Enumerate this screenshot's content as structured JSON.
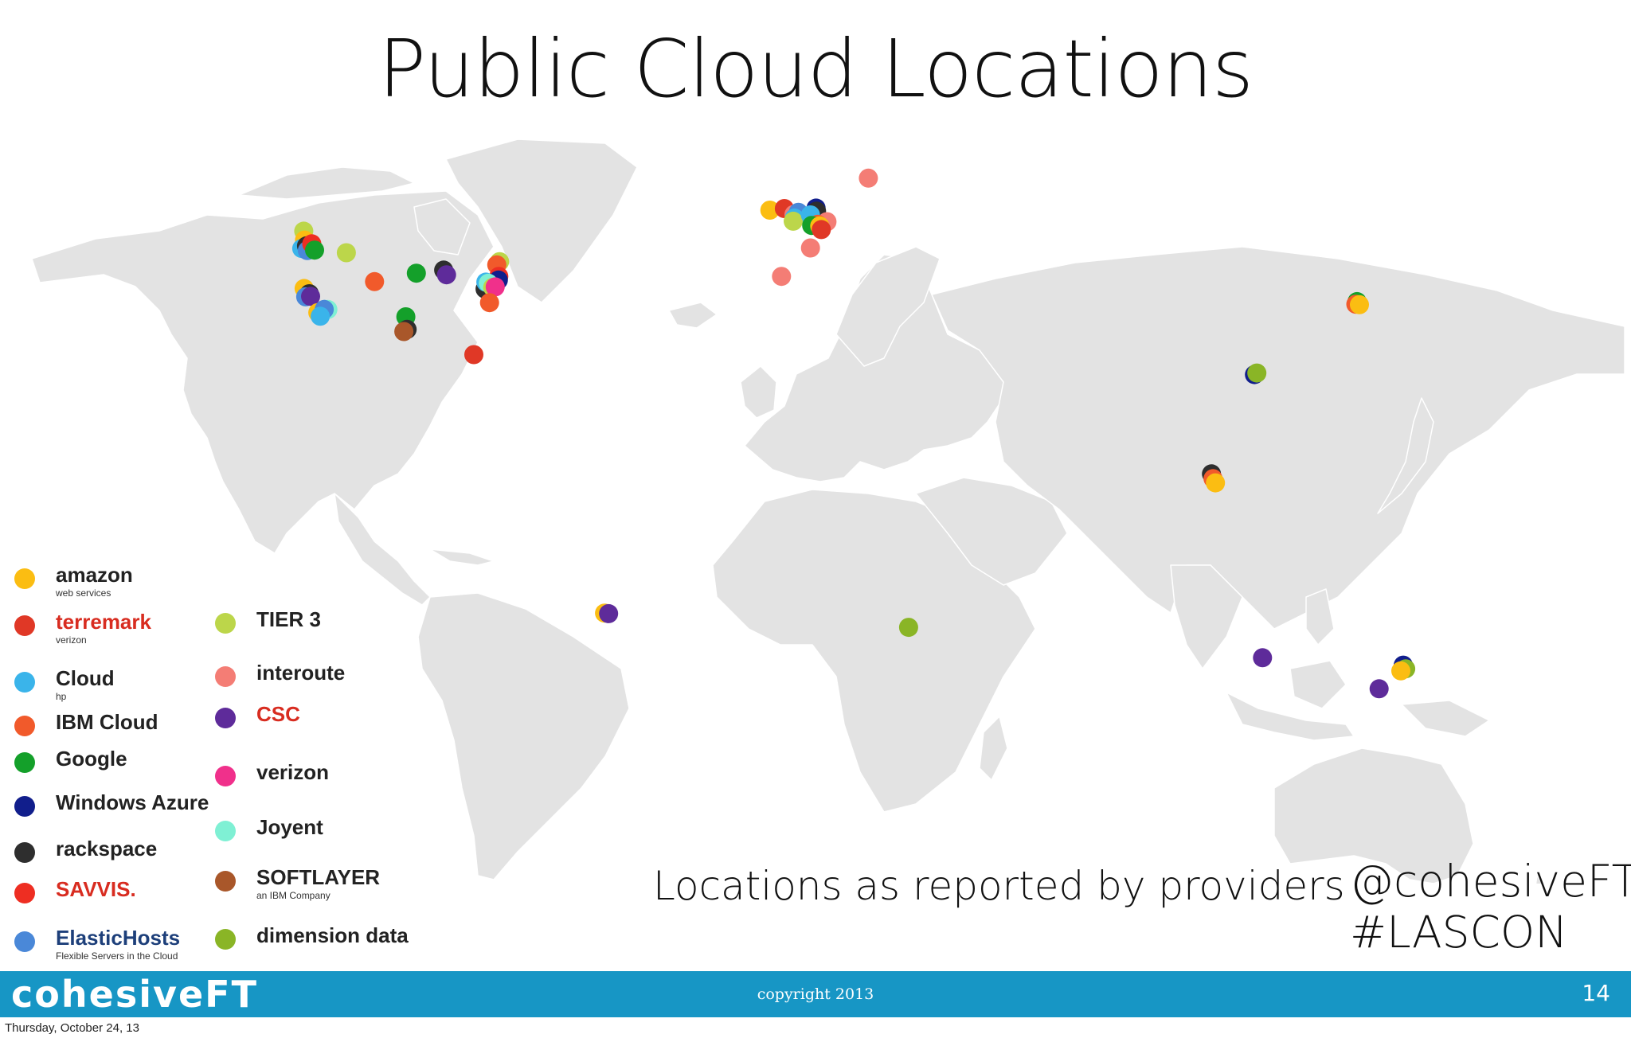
{
  "slide": {
    "title": "Public Cloud Locations",
    "caption": "Locations as reported by providers",
    "handle": "@cohesiveFT",
    "hashtag": "#LASCON",
    "footer_brand": "cohesiveFT",
    "footer_copyright": "copyright 2013",
    "page_number": "14",
    "date": "Thursday, October 24, 13"
  },
  "map": {
    "land_color": "#e3e3e3",
    "border_color": "#ffffff"
  },
  "providers": [
    {
      "id": "amazon",
      "label": "amazon",
      "sublabel": "web services",
      "color": "#fbbd12"
    },
    {
      "id": "terremark",
      "label": "terremark",
      "sublabel": "verizon",
      "color": "#e03826"
    },
    {
      "id": "hp",
      "label": "Cloud",
      "sublabel": "hp",
      "color": "#3ab4ea"
    },
    {
      "id": "ibm",
      "label": "IBM Cloud",
      "sublabel": "",
      "color": "#f15a2b"
    },
    {
      "id": "google",
      "label": "Google",
      "sublabel": "",
      "color": "#14a02a"
    },
    {
      "id": "azure",
      "label": "Windows Azure",
      "sublabel": "",
      "color": "#111e8c"
    },
    {
      "id": "rackspace",
      "label": "rackspace",
      "sublabel": "",
      "color": "#2e2e2e"
    },
    {
      "id": "savvis",
      "label": "SAVVIS.",
      "sublabel": "",
      "color": "#ee2e22"
    },
    {
      "id": "elastichosts",
      "label": "ElasticHosts",
      "sublabel": "Flexible Servers in the Cloud",
      "color": "#4a88d8"
    },
    {
      "id": "tier3",
      "label": "TIER 3",
      "sublabel": "",
      "color": "#bcd64a"
    },
    {
      "id": "interoute",
      "label": "interoute",
      "sublabel": "",
      "color": "#f47d75"
    },
    {
      "id": "csc",
      "label": "CSC",
      "sublabel": "",
      "color": "#5e2b9a"
    },
    {
      "id": "verizon",
      "label": "verizon",
      "sublabel": "",
      "color": "#f0308b"
    },
    {
      "id": "joyent",
      "label": "Joyent",
      "sublabel": "",
      "color": "#7ff0d4"
    },
    {
      "id": "softlayer",
      "label": "SOFTLAYER",
      "sublabel": "an IBM Company",
      "color": "#a9572a"
    },
    {
      "id": "dimension",
      "label": "dimension data",
      "sublabel": "",
      "color": "#8ab526"
    }
  ],
  "locations": [
    {
      "p": "tier3",
      "lon": -122.5,
      "lat": 49.3
    },
    {
      "p": "amazon",
      "lon": -122.3,
      "lat": 47.6
    },
    {
      "p": "hp",
      "lon": -123.0,
      "lat": 46.0
    },
    {
      "p": "rackspace",
      "lon": -121.8,
      "lat": 46.5
    },
    {
      "p": "elastichosts",
      "lon": -121.6,
      "lat": 45.6
    },
    {
      "p": "savvis",
      "lon": -120.5,
      "lat": 46.9
    },
    {
      "p": "google",
      "lon": -119.8,
      "lat": 45.7
    },
    {
      "p": "tier3",
      "lon": -111.9,
      "lat": 45.2
    },
    {
      "p": "ibm",
      "lon": -104.9,
      "lat": 39.7
    },
    {
      "p": "amazon",
      "lon": -122.4,
      "lat": 38.4
    },
    {
      "p": "rackspace",
      "lon": -121.1,
      "lat": 37.4
    },
    {
      "p": "elastichosts",
      "lon": -122.0,
      "lat": 36.8
    },
    {
      "p": "csc",
      "lon": -120.8,
      "lat": 36.9
    },
    {
      "p": "amazon",
      "lon": -119.0,
      "lat": 33.8
    },
    {
      "p": "hp",
      "lon": -117.3,
      "lat": 34.4
    },
    {
      "p": "joyent",
      "lon": -116.5,
      "lat": 34.4
    },
    {
      "p": "elastichosts",
      "lon": -117.4,
      "lat": 34.4
    },
    {
      "p": "hp",
      "lon": -118.4,
      "lat": 33.1
    },
    {
      "p": "google",
      "lon": -94.5,
      "lat": 41.3
    },
    {
      "p": "google",
      "lon": -97.1,
      "lat": 33.0
    },
    {
      "p": "rackspace",
      "lon": -96.8,
      "lat": 30.6
    },
    {
      "p": "softlayer",
      "lon": -97.6,
      "lat": 30.2
    },
    {
      "p": "rackspace",
      "lon": -87.7,
      "lat": 41.9
    },
    {
      "p": "csc",
      "lon": -87.0,
      "lat": 41.0
    },
    {
      "p": "tier3",
      "lon": -73.8,
      "lat": 43.5
    },
    {
      "p": "ibm",
      "lon": -74.5,
      "lat": 42.9
    },
    {
      "p": "savvis",
      "lon": -74.0,
      "lat": 40.7
    },
    {
      "p": "azure",
      "lon": -74.1,
      "lat": 40.0
    },
    {
      "p": "rackspace",
      "lon": -77.4,
      "lat": 38.3
    },
    {
      "p": "hp",
      "lon": -77.2,
      "lat": 39.6
    },
    {
      "p": "joyent",
      "lon": -76.6,
      "lat": 39.4
    },
    {
      "p": "tier3",
      "lon": -75.5,
      "lat": 38.6
    },
    {
      "p": "verizon",
      "lon": -74.9,
      "lat": 38.7
    },
    {
      "p": "ibm",
      "lon": -76.3,
      "lat": 35.7
    },
    {
      "p": "terremark",
      "lon": -80.2,
      "lat": 25.8
    },
    {
      "p": "amazon",
      "lon": -6.6,
      "lat": 53.3
    },
    {
      "p": "terremark",
      "lon": -3.0,
      "lat": 53.6
    },
    {
      "p": "interoute",
      "lon": -0.6,
      "lat": 52.5
    },
    {
      "p": "elastichosts",
      "lon": 0.5,
      "lat": 52.9
    },
    {
      "p": "hp",
      "lon": -0.5,
      "lat": 51.8
    },
    {
      "p": "tier3",
      "lon": -0.8,
      "lat": 51.2
    },
    {
      "p": "azure",
      "lon": 4.9,
      "lat": 53.7
    },
    {
      "p": "rackspace",
      "lon": 5.0,
      "lat": 53.1
    },
    {
      "p": "hp",
      "lon": 3.5,
      "lat": 52.4
    },
    {
      "p": "interoute",
      "lon": 7.6,
      "lat": 51.1
    },
    {
      "p": "ibm",
      "lon": 5.3,
      "lat": 50.6
    },
    {
      "p": "google",
      "lon": 3.8,
      "lat": 50.4
    },
    {
      "p": "amazon",
      "lon": 5.8,
      "lat": 50.3
    },
    {
      "p": "terremark",
      "lon": 6.2,
      "lat": 49.6
    },
    {
      "p": "interoute",
      "lon": 3.5,
      "lat": 46.1
    },
    {
      "p": "interoute",
      "lon": 17.9,
      "lat": 59.4
    },
    {
      "p": "interoute",
      "lon": -3.7,
      "lat": 40.7
    },
    {
      "p": "google",
      "lon": 139.4,
      "lat": 35.9
    },
    {
      "p": "ibm",
      "lon": 139.1,
      "lat": 35.4
    },
    {
      "p": "amazon",
      "lon": 140.0,
      "lat": 35.3
    },
    {
      "p": "azure",
      "lon": 113.9,
      "lat": 22.0
    },
    {
      "p": "dimension",
      "lon": 114.5,
      "lat": 22.3
    },
    {
      "p": "rackspace",
      "lon": 103.2,
      "lat": 3.1
    },
    {
      "p": "ibm",
      "lon": 103.6,
      "lat": 2.2
    },
    {
      "p": "amazon",
      "lon": 104.2,
      "lat": 1.4
    },
    {
      "p": "amazon",
      "lon": -47.7,
      "lat": -23.4
    },
    {
      "p": "csc",
      "lon": -46.7,
      "lat": -23.5
    },
    {
      "p": "dimension",
      "lon": 27.9,
      "lat": -26.1
    },
    {
      "p": "csc",
      "lon": 115.9,
      "lat": -31.9
    },
    {
      "p": "azure",
      "lon": 150.9,
      "lat": -33.3
    },
    {
      "p": "dimension",
      "lon": 151.5,
      "lat": -34.0
    },
    {
      "p": "amazon",
      "lon": 150.3,
      "lat": -34.4
    },
    {
      "p": "csc",
      "lon": 144.9,
      "lat": -37.8
    }
  ]
}
